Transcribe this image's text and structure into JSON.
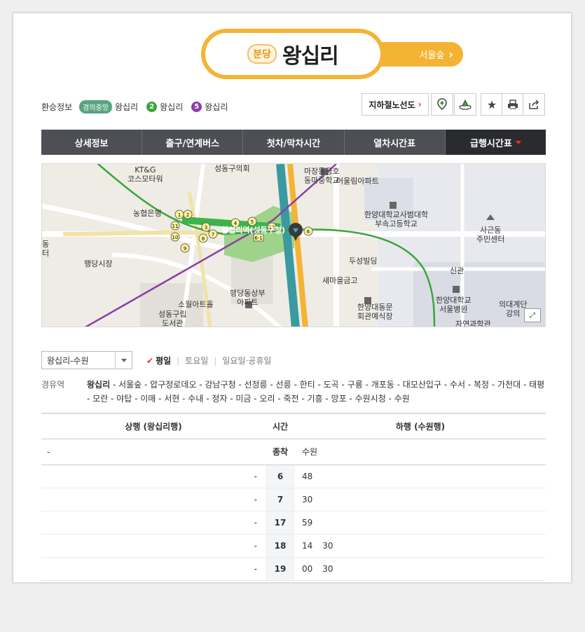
{
  "station": {
    "line_badge": "분당",
    "name": "왕십리",
    "next_station": "서울숲"
  },
  "transfer": {
    "label": "환승정보",
    "items": [
      {
        "tag": "경의중앙",
        "name": "왕십리",
        "color": "#5aa483"
      },
      {
        "num": "2",
        "name": "왕십리",
        "color": "#3aa53a"
      },
      {
        "num": "5",
        "name": "왕십리",
        "color": "#8b3fa6"
      }
    ]
  },
  "toolbar": {
    "subway_map_label": "지하철노선도",
    "icons": [
      "map-pin-icon",
      "location-icon",
      "star-icon",
      "print-icon",
      "share-icon"
    ]
  },
  "tabs": [
    "상세정보",
    "출구/연계버스",
    "첫차/막차시간",
    "열차시간표",
    "급행시간표"
  ],
  "map": {
    "labels": {
      "kt": "KT&G\n코스모타워",
      "seongdong_council": "성동구의회",
      "majang": "마장동금호\n동마중학교",
      "apartment": "어울림아파트",
      "nonghyup": "농협은행",
      "hanyang_school": "한양대학교사범대학\n부속고등학교",
      "sagun": "사근동\n주민센터",
      "haengdang": "행당시장",
      "station_label": "왕십리역(성동구청)",
      "duseong": "두성빌딩",
      "saemaeul": "새마을금고",
      "haengdang_apt": "행당동상부\n아파트",
      "sowol": "소월아트홀",
      "hanyang_hall": "한양대동문\n회관예식장",
      "seongdong_library": "성동구립\n도서관",
      "hospital": "한양대학교\n서울병원",
      "singwan": "신관",
      "jayeon": "자연과학관",
      "uidae": "의대계단\n강의",
      "dong_left": "동\n터"
    }
  },
  "filters": {
    "direction": "왕십리-수원",
    "days": [
      "평일",
      "토요일",
      "일요일·공휴일"
    ],
    "active_day": "평일"
  },
  "via": {
    "label": "경유역",
    "first": "왕십리",
    "rest": " - 서울숲 - 압구정로데오 - 강남구청 - 선정릉 - 선릉 - 한티 - 도곡 - 구룡 - 개포동 - 대모산입구 - 수서 - 복정 - 가천대 - 태평 - 모란 - 야탑 - 이매 - 서현 - 수내 - 정자 - 미금 - 오리 - 죽전 - 기흥 - 망포 - 수원시청 - 수원"
  },
  "timetable": {
    "headers": {
      "up": "상행 (왕십리행)",
      "hour": "시간",
      "down": "하행 (수원행)"
    },
    "first_row": {
      "up": "-",
      "hour": "종착",
      "down": "수원"
    },
    "rows": [
      {
        "up": "-",
        "hour": "6",
        "down": [
          "48"
        ]
      },
      {
        "up": "-",
        "hour": "7",
        "down": [
          "30"
        ]
      },
      {
        "up": "-",
        "hour": "17",
        "down": [
          "59"
        ]
      },
      {
        "up": "-",
        "hour": "18",
        "down": [
          "14",
          "30"
        ]
      },
      {
        "up": "-",
        "hour": "19",
        "down": [
          "00",
          "30"
        ]
      }
    ]
  }
}
